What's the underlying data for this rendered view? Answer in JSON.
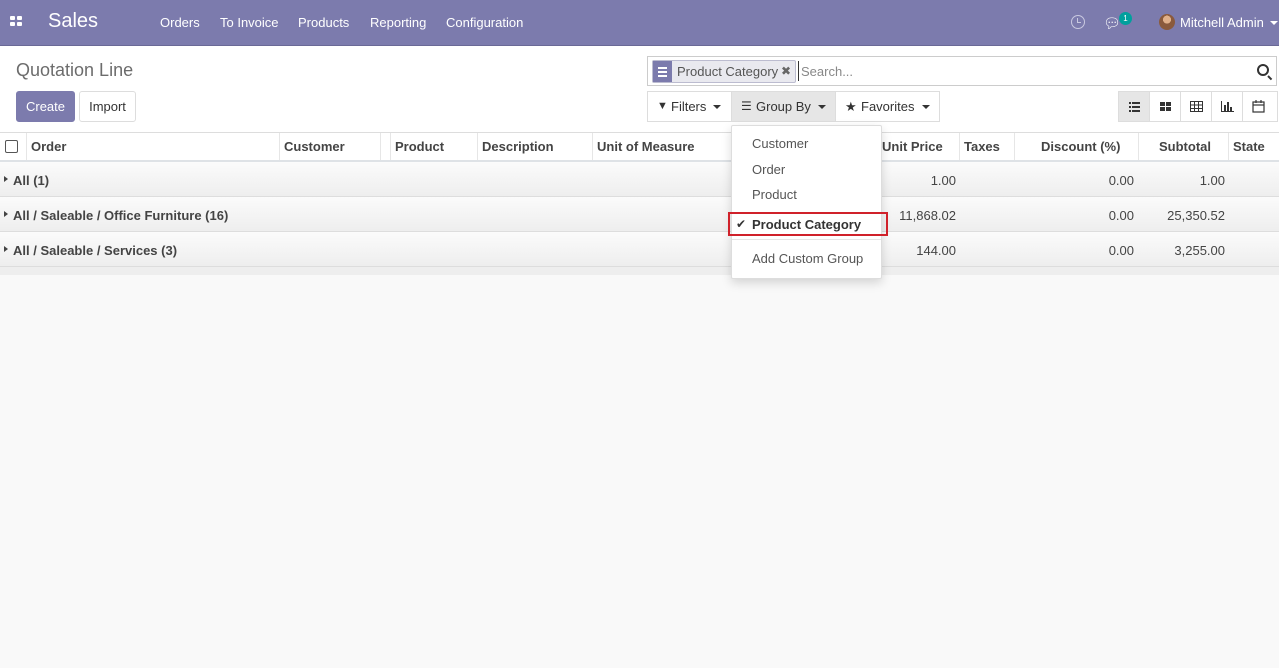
{
  "navbar": {
    "app_name": "Sales",
    "menu": [
      "Orders",
      "To Invoice",
      "Products",
      "Reporting",
      "Configuration"
    ],
    "chat_badge": "1",
    "user_name": "Mitchell Admin"
  },
  "control_panel": {
    "breadcrumb": "Quotation Line",
    "create_label": "Create",
    "import_label": "Import",
    "search": {
      "facet_value": "Product Category",
      "placeholder": "Search..."
    },
    "filters_label": "Filters",
    "groupby_label": "Group By",
    "favorites_label": "Favorites",
    "views": [
      "list-view-icon",
      "kanban-view-icon",
      "pivot-view-icon",
      "graph-view-icon",
      "calendar-view-icon"
    ]
  },
  "table": {
    "columns": [
      "Order",
      "Customer",
      "Product",
      "Description",
      "Unit of Measure",
      "Unit Price",
      "Taxes",
      "Discount (%)",
      "Subtotal",
      "State"
    ],
    "groups": [
      {
        "name": "All (1)",
        "unit_price": "1.00",
        "discount": "0.00",
        "subtotal": "1.00"
      },
      {
        "name": "All / Saleable / Office Furniture (16)",
        "unit_price": "11,868.02",
        "discount": "0.00",
        "subtotal": "25,350.52"
      },
      {
        "name": "All / Saleable / Services (3)",
        "unit_price": "144.00",
        "discount": "0.00",
        "subtotal": "3,255.00"
      }
    ]
  },
  "groupby_menu": {
    "items": [
      "Customer",
      "Order",
      "Product"
    ],
    "selected": "Product Category",
    "add_custom": "Add Custom Group"
  },
  "colors": {
    "brand": "#7c7bad",
    "highlight": "#d0212a",
    "badge": "#00a09d"
  }
}
